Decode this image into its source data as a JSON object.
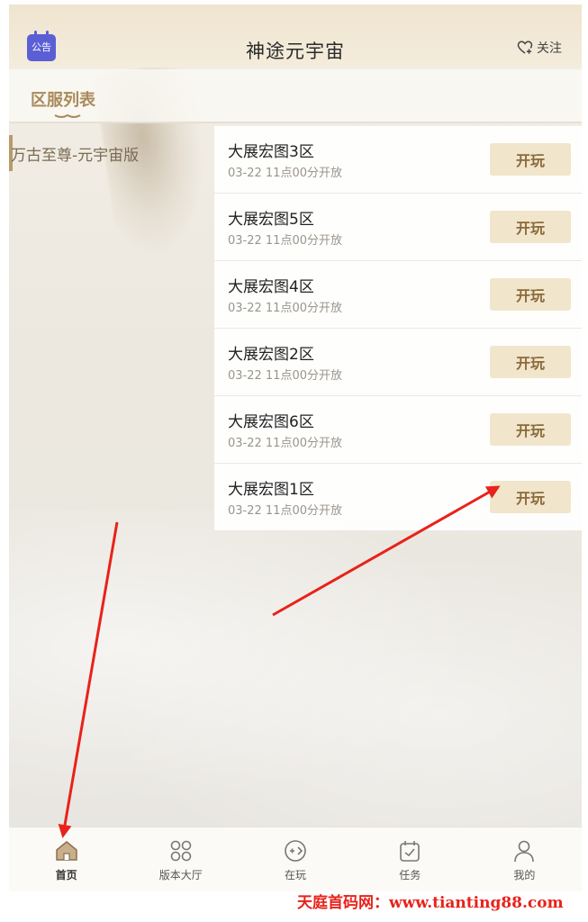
{
  "header": {
    "notice_label": "公告",
    "title": "神途元宇宙",
    "follow_label": "关注"
  },
  "tabs": {
    "active_label": "区服列表"
  },
  "games": [
    {
      "label": "万古至尊-元宇宙版"
    }
  ],
  "servers": [
    {
      "name": "大展宏图3区",
      "time": "03-22 11点00分开放",
      "button": "开玩"
    },
    {
      "name": "大展宏图5区",
      "time": "03-22 11点00分开放",
      "button": "开玩"
    },
    {
      "name": "大展宏图4区",
      "time": "03-22 11点00分开放",
      "button": "开玩"
    },
    {
      "name": "大展宏图2区",
      "time": "03-22 11点00分开放",
      "button": "开玩"
    },
    {
      "name": "大展宏图6区",
      "time": "03-22 11点00分开放",
      "button": "开玩"
    },
    {
      "name": "大展宏图1区",
      "time": "03-22 11点00分开放",
      "button": "开玩"
    }
  ],
  "bottom_nav": [
    {
      "label": "首页",
      "icon": "home-icon",
      "active": true
    },
    {
      "label": "版本大厅",
      "icon": "grid-icon",
      "active": false
    },
    {
      "label": "在玩",
      "icon": "game-icon",
      "active": false
    },
    {
      "label": "任务",
      "icon": "calendar-check-icon",
      "active": false
    },
    {
      "label": "我的",
      "icon": "user-icon",
      "active": false
    }
  ],
  "watermark": "天庭首码网：www.tianting88.com",
  "colors": {
    "accent_gold": "#a98a5a",
    "button_bg": "#f1e5cc",
    "notice_purple": "#5b5fd6",
    "annotation_red": "#e8221a"
  }
}
